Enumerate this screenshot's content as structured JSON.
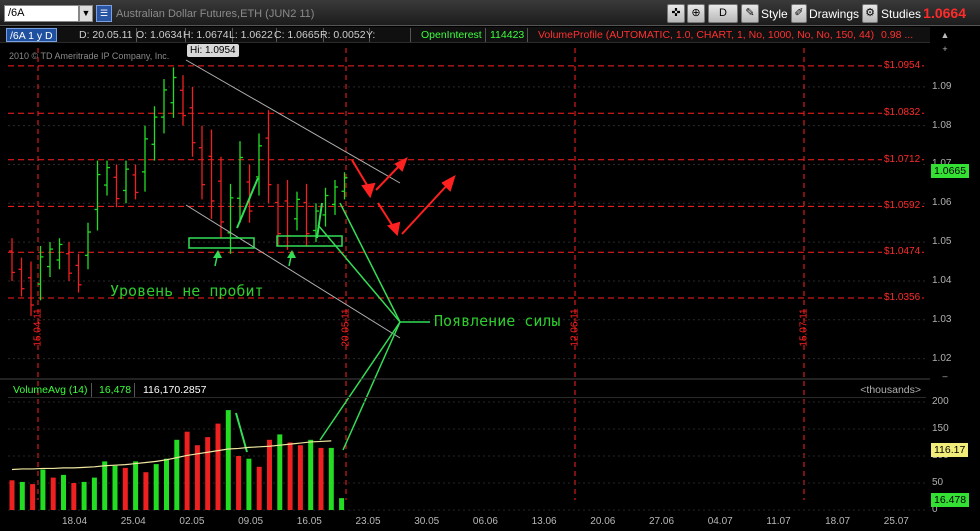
{
  "toolbar": {
    "symbol": "/6A",
    "description": "Australian Dollar Futures,ETH (JUN2 11)",
    "period_button": "D",
    "style_label": "Style",
    "drawings_label": "Drawings",
    "studies_label": "Studies",
    "last_price": "1.0664"
  },
  "infobar": {
    "ticker": "/6A 1 y D",
    "date": "D: 20.05.11",
    "open": "O: 1.0634",
    "high": "H: 1.0674",
    "low": "L: 1.0622",
    "close": "C: 1.0665",
    "range": "R: 0.0052",
    "y": "Y:",
    "oi_label": "OpenInterest",
    "oi_value": "114423",
    "volume_profile": "VolumeProfile (AUTOMATIC, 1.0, CHART, 1, No, 1000, No, No, 150, 44)",
    "trail": "0.98 ..."
  },
  "copyright": "2010 © TD Ameritrade IP Company, Inc.",
  "hi_label": "Hi: 1.0954",
  "price_axis": [
    "1.09",
    "1.08",
    "1.07",
    "1.06",
    "1.05",
    "1.04",
    "1.03",
    "1.02"
  ],
  "levels": [
    "$1.0954",
    "$1.0832",
    "$1.0712",
    "$1.0592",
    "$1.0474",
    "$1.0356"
  ],
  "current_price_badge": "1.0665",
  "vertical_markers": [
    "15.04.11",
    "20.05.11",
    "12.06.11",
    "15.07.11"
  ],
  "annotations": {
    "level_not_broken": "Уровень не пробит",
    "strength_appears": "Появление силы"
  },
  "volume": {
    "study": "VolumeAvg (14)",
    "value": "16,478",
    "avg": "116,170.2857",
    "units": "<thousands>",
    "axis": [
      "200",
      "150",
      "100",
      "50",
      "0"
    ],
    "badge_avg": "116.17",
    "badge_vol": "16.478"
  },
  "x_axis": [
    "18.04",
    "25.04",
    "02.05",
    "09.05",
    "16.05",
    "23.05",
    "30.05",
    "06.06",
    "13.06",
    "20.06",
    "27.06",
    "04.07",
    "11.07",
    "18.07",
    "25.07"
  ],
  "colors": {
    "up": "#22dd22",
    "down": "#ee2020",
    "level": "#ff2020",
    "accent": "#2050a0"
  },
  "chart_data": {
    "type": "candlestick",
    "price_range": [
      1.015,
      1.1
    ],
    "bars": [
      {
        "h": 1.051,
        "l": 1.04,
        "up": false
      },
      {
        "h": 1.046,
        "l": 1.036,
        "up": false
      },
      {
        "h": 1.045,
        "l": 1.031,
        "up": false
      },
      {
        "h": 1.049,
        "l": 1.035,
        "up": true
      },
      {
        "h": 1.05,
        "l": 1.041,
        "up": true
      },
      {
        "h": 1.051,
        "l": 1.043,
        "up": true
      },
      {
        "h": 1.05,
        "l": 1.04,
        "up": false
      },
      {
        "h": 1.047,
        "l": 1.037,
        "up": false
      },
      {
        "h": 1.055,
        "l": 1.043,
        "up": true
      },
      {
        "h": 1.071,
        "l": 1.053,
        "up": true
      },
      {
        "h": 1.071,
        "l": 1.062,
        "up": true
      },
      {
        "h": 1.07,
        "l": 1.059,
        "up": false
      },
      {
        "h": 1.071,
        "l": 1.06,
        "up": true
      },
      {
        "h": 1.07,
        "l": 1.061,
        "up": false
      },
      {
        "h": 1.08,
        "l": 1.063,
        "up": true
      },
      {
        "h": 1.085,
        "l": 1.071,
        "up": true
      },
      {
        "h": 1.092,
        "l": 1.078,
        "up": true
      },
      {
        "h": 1.095,
        "l": 1.082,
        "up": true
      },
      {
        "h": 1.093,
        "l": 1.08,
        "up": false
      },
      {
        "h": 1.09,
        "l": 1.072,
        "up": false
      },
      {
        "h": 1.08,
        "l": 1.061,
        "up": false
      },
      {
        "h": 1.079,
        "l": 1.056,
        "up": false
      },
      {
        "h": 1.072,
        "l": 1.051,
        "up": false
      },
      {
        "h": 1.065,
        "l": 1.047,
        "up": true
      },
      {
        "h": 1.076,
        "l": 1.055,
        "up": true
      },
      {
        "h": 1.07,
        "l": 1.055,
        "up": false
      },
      {
        "h": 1.078,
        "l": 1.062,
        "up": true
      },
      {
        "h": 1.084,
        "l": 1.06,
        "up": false
      },
      {
        "h": 1.065,
        "l": 1.049,
        "up": false
      },
      {
        "h": 1.066,
        "l": 1.048,
        "up": false
      },
      {
        "h": 1.063,
        "l": 1.053,
        "up": true
      },
      {
        "h": 1.065,
        "l": 1.049,
        "up": false
      },
      {
        "h": 1.06,
        "l": 1.05,
        "up": true
      },
      {
        "h": 1.064,
        "l": 1.054,
        "up": true
      },
      {
        "h": 1.066,
        "l": 1.057,
        "up": true
      },
      {
        "h": 1.068,
        "l": 1.061,
        "up": true
      }
    ],
    "volume": [
      {
        "v": 55,
        "up": false
      },
      {
        "v": 52,
        "up": true
      },
      {
        "v": 48,
        "up": false
      },
      {
        "v": 75,
        "up": true
      },
      {
        "v": 60,
        "up": false
      },
      {
        "v": 65,
        "up": true
      },
      {
        "v": 50,
        "up": false
      },
      {
        "v": 52,
        "up": true
      },
      {
        "v": 60,
        "up": true
      },
      {
        "v": 90,
        "up": true
      },
      {
        "v": 82,
        "up": true
      },
      {
        "v": 78,
        "up": false
      },
      {
        "v": 90,
        "up": true
      },
      {
        "v": 70,
        "up": false
      },
      {
        "v": 85,
        "up": true
      },
      {
        "v": 95,
        "up": true
      },
      {
        "v": 130,
        "up": true
      },
      {
        "v": 145,
        "up": false
      },
      {
        "v": 120,
        "up": false
      },
      {
        "v": 135,
        "up": false
      },
      {
        "v": 160,
        "up": false
      },
      {
        "v": 185,
        "up": true
      },
      {
        "v": 100,
        "up": false
      },
      {
        "v": 95,
        "up": true
      },
      {
        "v": 80,
        "up": false
      },
      {
        "v": 130,
        "up": false
      },
      {
        "v": 140,
        "up": true
      },
      {
        "v": 125,
        "up": false
      },
      {
        "v": 120,
        "up": false
      },
      {
        "v": 130,
        "up": true
      },
      {
        "v": 115,
        "up": false
      },
      {
        "v": 115,
        "up": true
      },
      {
        "v": 22,
        "up": true
      }
    ],
    "volume_range": [
      0,
      200
    ],
    "title": "Australian Dollar Futures,ETH (JUN2 11)"
  }
}
